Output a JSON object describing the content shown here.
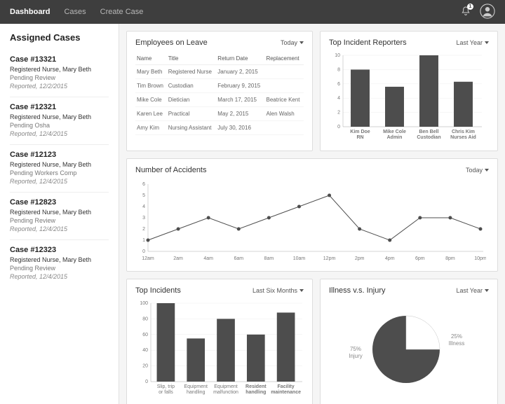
{
  "nav": {
    "items": [
      "Dashboard",
      "Cases",
      "Create Case"
    ],
    "active": 0
  },
  "notifications": {
    "count": "1"
  },
  "sidebar": {
    "title": "Assigned Cases",
    "cases": [
      {
        "num": "Case #13321",
        "role": "Registered Nurse, Mary Beth",
        "status": "Pending Review",
        "reported": "Reported, 12/2/2015"
      },
      {
        "num": "Case #12321",
        "role": "Registered Nurse, Mary Beth",
        "status": "Pending Osha",
        "reported": "Reported, 12/4/2015"
      },
      {
        "num": "Case #12123",
        "role": "Registered Nurse, Mary Beth",
        "status": "Pending Workers Comp",
        "reported": "Reported, 12/4/2015"
      },
      {
        "num": "Case #12823",
        "role": "Registered Nurse, Mary Beth",
        "status": "Pending Review",
        "reported": "Reported, 12/4/2015"
      },
      {
        "num": "Case #12323",
        "role": "Registered Nurse, Mary Beth",
        "status": "Pending Review",
        "reported": "Reported, 12/4/2015"
      }
    ]
  },
  "cards": {
    "leave": {
      "title": "Employees on Leave",
      "dropdown": "Today",
      "cols": [
        "Name",
        "Title",
        "Return Date",
        "Replacement"
      ],
      "rows": [
        [
          "Mary Beth",
          "Registered Nurse",
          "January 2, 2015",
          ""
        ],
        [
          "Tim Brown",
          "Custodian",
          "February 9, 2015",
          ""
        ],
        [
          "Mike Cole",
          "Dietician",
          "March 17, 2015",
          "Beatrice Kent"
        ],
        [
          "Karen Lee",
          "Practical",
          "May 2, 2015",
          "Alen Walsh"
        ],
        [
          "Amy Kim",
          "Nursing Assistant",
          "July  30, 2016",
          ""
        ]
      ]
    },
    "reporters": {
      "title": "Top Incident Reporters",
      "dropdown": "Last Year"
    },
    "accidents": {
      "title": "Number of Accidents",
      "dropdown": "Today"
    },
    "incidents": {
      "title": "Top Incidents",
      "dropdown": "Last Six Months"
    },
    "illness": {
      "title": "Illness v.s. Injury",
      "dropdown": "Last Year"
    }
  },
  "chart_data": [
    {
      "id": "reporters",
      "type": "bar",
      "categories": [
        "Kim Doe RN",
        "Mike Cole Admin",
        "Ben Bell Custodian",
        "Chris Kim Nurses Aid"
      ],
      "values": [
        8,
        5.6,
        10,
        6.3
      ],
      "yticks": [
        0,
        2,
        4,
        6,
        8,
        10
      ],
      "ylim": [
        0,
        10
      ]
    },
    {
      "id": "accidents",
      "type": "line",
      "x": [
        "12am",
        "2am",
        "4am",
        "6am",
        "8am",
        "10am",
        "12pm",
        "2pm",
        "4pm",
        "6pm",
        "8pm",
        "10pm"
      ],
      "y": [
        1,
        2,
        3,
        2,
        3,
        4,
        5,
        2,
        1,
        3,
        3,
        2
      ],
      "yticks": [
        0,
        1,
        2,
        3,
        4,
        5,
        6
      ],
      "ylim": [
        0,
        6
      ]
    },
    {
      "id": "incidents",
      "type": "bar",
      "categories": [
        "Slip, trip or falls",
        "Equipment handling",
        "Equipment malfunction",
        "Resident handling",
        "Facility maintenance"
      ],
      "values": [
        100,
        55,
        80,
        60,
        88
      ],
      "yticks": [
        0,
        20,
        40,
        60,
        80,
        100
      ],
      "ylim": [
        0,
        100
      ]
    },
    {
      "id": "illness",
      "type": "pie",
      "slices": [
        {
          "label": "75% Injury",
          "value": 75
        },
        {
          "label": "25% Illness",
          "value": 25
        }
      ]
    }
  ]
}
